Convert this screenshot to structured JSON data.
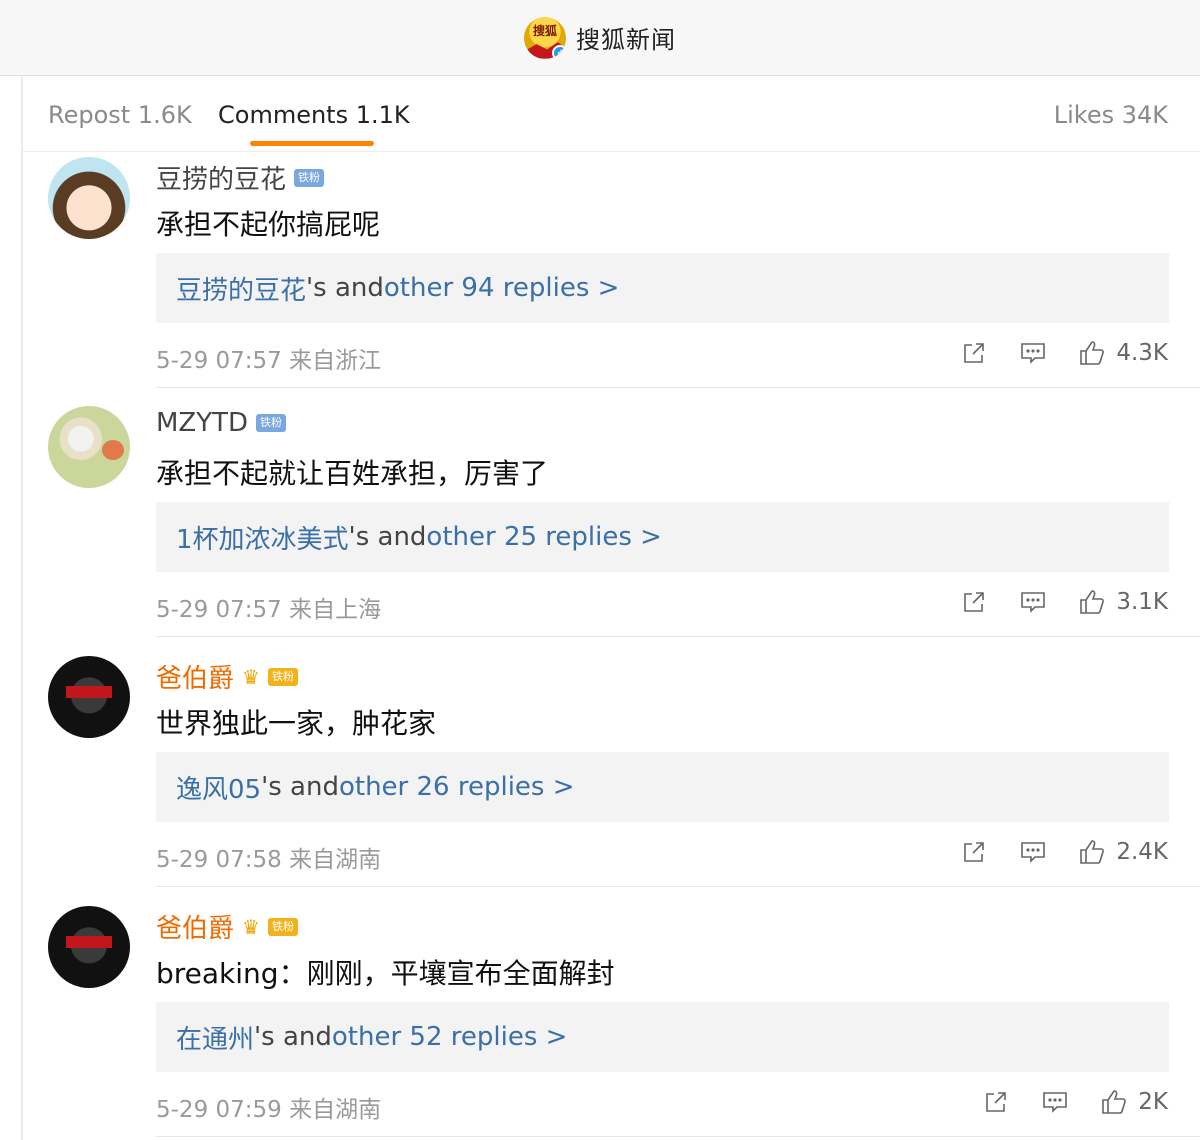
{
  "header": {
    "logo_text": "搜狐",
    "title": "搜狐新闻"
  },
  "tabs": {
    "repost": "Repost 1.6K",
    "comments": "Comments 1.1K",
    "likes": "Likes 34K"
  },
  "comments": [
    {
      "username": "豆捞的豆花",
      "badge": "铁粉",
      "text": "承担不起你搞屁呢",
      "reply_user": "豆捞的豆花",
      "reply_mid": "'s and ",
      "reply_more": "other 94 replies >",
      "meta": "5-29 07:57 来自浙江",
      "likes": "4.3K"
    },
    {
      "username": "MZYTD",
      "badge": "铁粉",
      "text": "承担不起就让百姓承担，厉害了",
      "reply_user": "1杯加浓冰美式",
      "reply_mid": "'s and ",
      "reply_more": "other 25 replies >",
      "meta": "5-29 07:57 来自上海",
      "likes": "3.1K"
    },
    {
      "username": "爸伯爵",
      "badge": "铁粉",
      "text": "世界独此一家，肿花家",
      "reply_user": "逸风05",
      "reply_mid": "'s and ",
      "reply_more": "other 26 replies >",
      "meta": "5-29 07:58 来自湖南",
      "likes": "2.4K"
    },
    {
      "username": "爸伯爵",
      "badge": "铁粉",
      "text": "breaking：刚刚，平壤宣布全面解封",
      "reply_user": "在通州",
      "reply_mid": "'s and ",
      "reply_more": "other 52 replies >",
      "meta": "5-29 07:59 来自湖南",
      "likes": "2K"
    }
  ]
}
